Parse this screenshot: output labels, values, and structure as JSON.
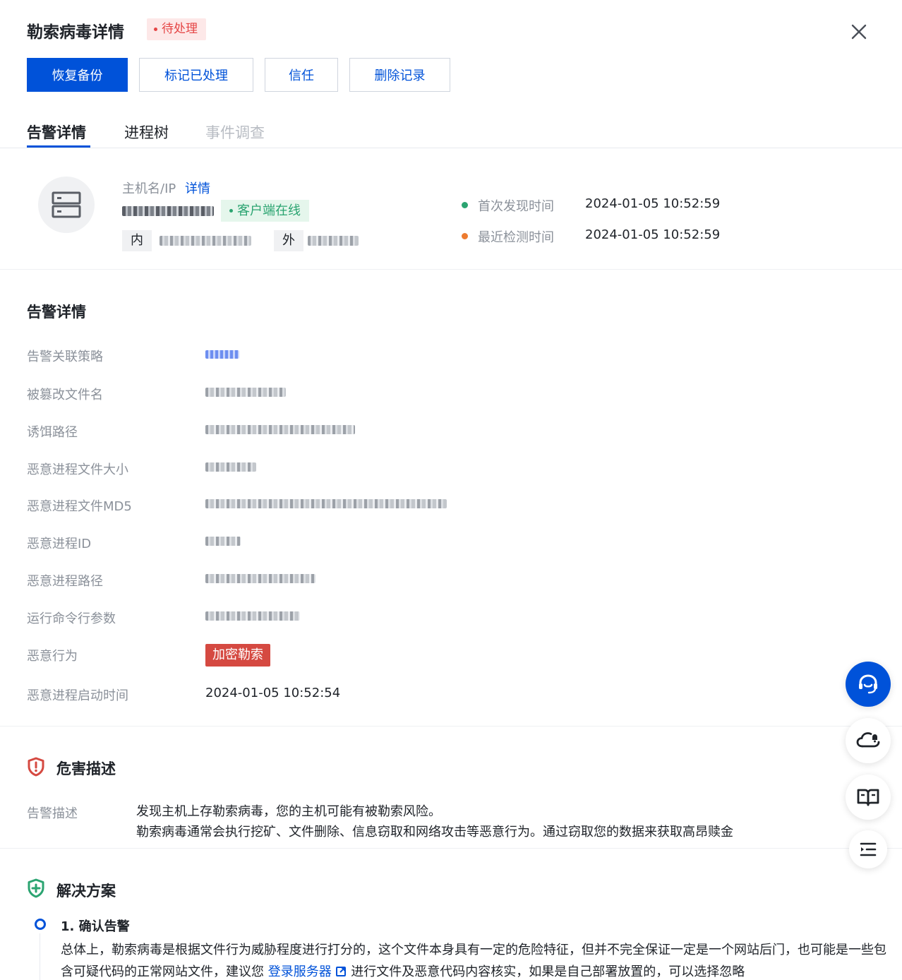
{
  "header": {
    "title": "勒索病毒详情",
    "status": "待处理",
    "actions": {
      "restore": "恢复备份",
      "mark_handled": "标记已处理",
      "trust": "信任",
      "delete": "删除记录"
    }
  },
  "tabs": [
    "告警详情",
    "进程树",
    "事件调查"
  ],
  "host": {
    "label": "主机名/IP",
    "detail_link": "详情",
    "online_status": "客户端在线",
    "inner_label": "内",
    "outer_label": "外",
    "first_found_label": "首次发现时间",
    "first_found_value": "2024-01-05 10:52:59",
    "last_check_label": "最近检测时间",
    "last_check_value": "2024-01-05 10:52:59"
  },
  "alert_details": {
    "title": "告警详情",
    "rows": [
      "告警关联策略",
      "被篡改文件名",
      "诱饵路径",
      "恶意进程文件大小",
      "恶意进程文件MD5",
      "恶意进程ID",
      "恶意进程路径",
      "运行命令行参数",
      "恶意行为",
      "恶意进程启动时间"
    ],
    "behavior_tag": "加密勒索",
    "start_time_value": "2024-01-05 10:52:54"
  },
  "harm": {
    "title": "危害描述",
    "label": "告警描述",
    "line1": "发现主机上存勒索病毒，您的主机可能有被勒索风险。",
    "line2": "勒索病毒通常会执行挖矿、文件删除、信息窃取和网络攻击等恶意行为。通过窃取您的数据来获取高昂赎金"
  },
  "solution": {
    "title": "解决方案",
    "step1_title": "1. 确认告警",
    "step1_text_a": "总体上，勒索病毒是根据文件行为威胁程度进行打分的，这个文件本身具有一定的危险特征，但并不完全保证一定是一个网站后门，也可能是一些包含可疑代码的正常网站文件，建议您",
    "step1_link": "登录服务器",
    "step1_text_b": "进行文件及恶意代码内容核实，如果是自己部署放置的，可以选择忽略"
  },
  "colors": {
    "brand": "#0052d9",
    "danger": "#d54941",
    "success": "#2ba471",
    "warning": "#ed7b2f"
  }
}
